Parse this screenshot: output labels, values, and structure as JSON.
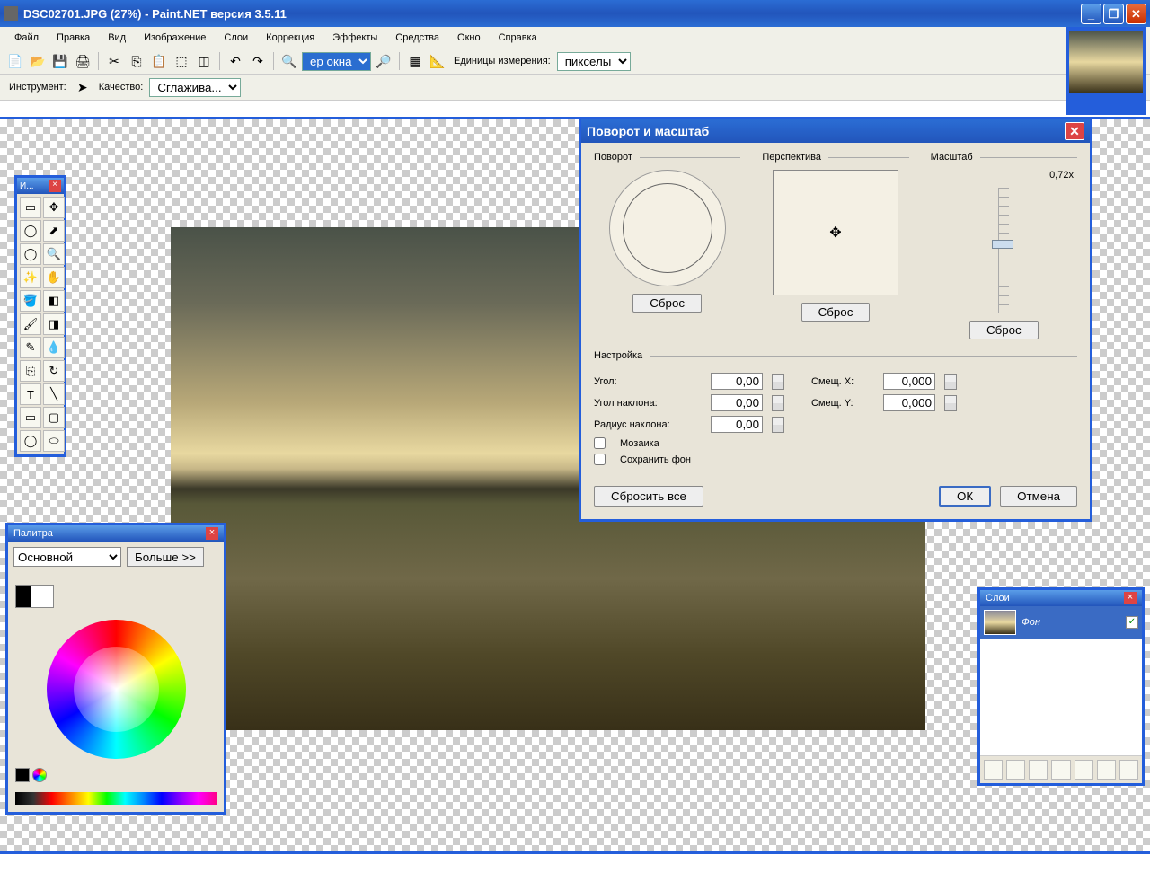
{
  "title": "DSC02701.JPG (27%) - Paint.NET версия 3.5.11",
  "menu": [
    "Файл",
    "Правка",
    "Вид",
    "Изображение",
    "Слои",
    "Коррекция",
    "Эффекты",
    "Средства",
    "Окно",
    "Справка"
  ],
  "toolbar": {
    "zoom_value": "ер окна",
    "units_label": "Единицы измерения:",
    "units_value": "пикселы",
    "instrument_label": "Инструмент:",
    "quality_label": "Качество:",
    "quality_value": "Сглажива..."
  },
  "tools_panel": {
    "title": "И..."
  },
  "colors_panel": {
    "title": "Палитра",
    "mode": "Основной",
    "more": "Больше >>"
  },
  "layers_panel": {
    "title": "Слои",
    "layer_name": "Фон"
  },
  "dialog": {
    "title": "Поворот и масштаб",
    "rotation_label": "Поворот",
    "perspective_label": "Перспектива",
    "scale_label": "Масштаб",
    "scale_value": "0,72x",
    "reset": "Сброс",
    "settings_label": "Настройка",
    "angle_label": "Угол:",
    "angle_value": "0,00",
    "tilt_label": "Угол наклона:",
    "tilt_value": "0,00",
    "radius_label": "Радиус наклона:",
    "radius_value": "0,00",
    "offx_label": "Смещ. X:",
    "offx_value": "0,000",
    "offy_label": "Смещ. Y:",
    "offy_value": "0,000",
    "mosaic": "Мозаика",
    "keepbg": "Сохранить фон",
    "reset_all": "Сбросить все",
    "ok": "ОК",
    "cancel": "Отмена"
  }
}
